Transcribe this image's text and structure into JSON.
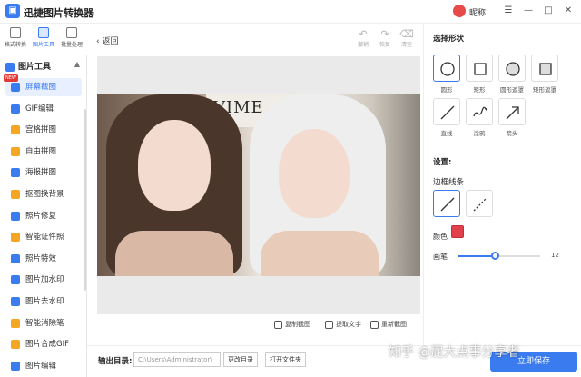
{
  "app": {
    "title": "迅捷图片转换器",
    "user_name": "昵称"
  },
  "window_controls": {
    "menu": "☰",
    "minimize": "—",
    "maximize": "□",
    "close": "✕"
  },
  "top_tabs": [
    {
      "label": "格式转换"
    },
    {
      "label": "图片工具"
    },
    {
      "label": "批量处理"
    }
  ],
  "sidebar": {
    "header": "图片工具",
    "new_badge": "NEW",
    "items": [
      {
        "label": "屏幕截图",
        "color": "#3a7bf0"
      },
      {
        "label": "GIF编辑",
        "color": "#3a7bf0"
      },
      {
        "label": "宫格拼图",
        "color": "#f5a623"
      },
      {
        "label": "自由拼图",
        "color": "#f5a623"
      },
      {
        "label": "海报拼图",
        "color": "#3a7bf0"
      },
      {
        "label": "抠图换背景",
        "color": "#f5a623"
      },
      {
        "label": "照片修复",
        "color": "#3a7bf0"
      },
      {
        "label": "智能证件照",
        "color": "#f5a623"
      },
      {
        "label": "照片特效",
        "color": "#3a7bf0"
      },
      {
        "label": "图片加水印",
        "color": "#3a7bf0"
      },
      {
        "label": "图片去水印",
        "color": "#3a7bf0"
      },
      {
        "label": "智能消除笔",
        "color": "#f5a623"
      },
      {
        "label": "图片合成GIF",
        "color": "#f5a623"
      },
      {
        "label": "图片编辑",
        "color": "#3a7bf0"
      }
    ]
  },
  "main": {
    "back_label": "返回",
    "toolbar": {
      "undo": "撤销",
      "redo": "恢复",
      "clear": "清空"
    },
    "image_text": "VIME",
    "bottom_actions": {
      "copy": "复制截图",
      "extract": "提取文字",
      "retake": "重新截图"
    }
  },
  "output": {
    "label": "输出目录:",
    "path": "C:\\Users\\Administrator\\",
    "change_dir": "更改目录",
    "open_folder": "打开文件夹",
    "start": "立即保存"
  },
  "watermark": "知乎 @屁大点事分享者",
  "right_panel": {
    "shape_title": "选择形状",
    "shapes": [
      {
        "label": "圆形"
      },
      {
        "label": "矩形"
      },
      {
        "label": "圆形遮罩"
      },
      {
        "label": "矩形遮罩"
      },
      {
        "label": "直线"
      },
      {
        "label": "涂鸦"
      },
      {
        "label": "箭头"
      }
    ],
    "settings_title": "设置:",
    "line_title": "边框线条",
    "color_label": "颜色",
    "color_value": "#e0414b",
    "brush_label": "画笔",
    "brush_value": "12",
    "brush_fraction": 0.45
  }
}
